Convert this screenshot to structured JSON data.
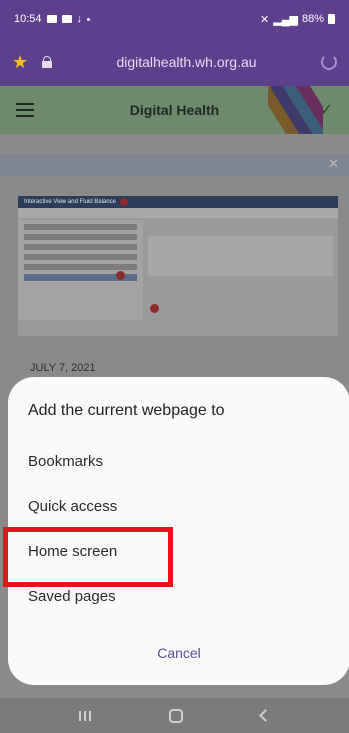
{
  "status_bar": {
    "time": "10:54",
    "battery": "88%"
  },
  "browser": {
    "url": "digitalhealth.wh.org.au"
  },
  "site": {
    "title": "Digital Health",
    "date": "JULY 7, 2021"
  },
  "preview": {
    "window_title": "Interactive View and Fluid Balance",
    "marker_1": "1",
    "marker_2": "2",
    "marker_3": "3"
  },
  "sheet": {
    "title": "Add the current webpage to",
    "items": [
      {
        "label": "Bookmarks"
      },
      {
        "label": "Quick access"
      },
      {
        "label": "Home screen"
      },
      {
        "label": "Saved pages"
      }
    ],
    "cancel": "Cancel",
    "highlighted_item": "Home screen"
  },
  "colors": {
    "accent": "#5e3f8c",
    "highlight": "#e8141c",
    "site_header": "#6e8a6d"
  },
  "icons": {
    "bookmark_star": "star-icon",
    "lock": "lock-icon",
    "reload": "reload-icon",
    "menu": "hamburger-icon",
    "check": "check-icon"
  }
}
